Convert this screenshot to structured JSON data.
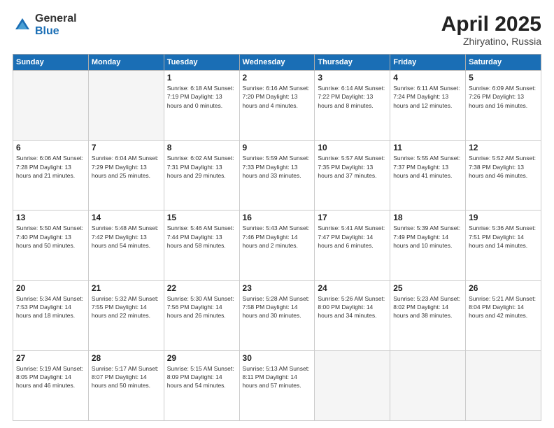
{
  "logo": {
    "general": "General",
    "blue": "Blue"
  },
  "title": "April 2025",
  "subtitle": "Zhiryatino, Russia",
  "weekdays": [
    "Sunday",
    "Monday",
    "Tuesday",
    "Wednesday",
    "Thursday",
    "Friday",
    "Saturday"
  ],
  "weeks": [
    [
      {
        "day": "",
        "info": ""
      },
      {
        "day": "",
        "info": ""
      },
      {
        "day": "1",
        "info": "Sunrise: 6:18 AM\nSunset: 7:19 PM\nDaylight: 13 hours\nand 0 minutes."
      },
      {
        "day": "2",
        "info": "Sunrise: 6:16 AM\nSunset: 7:20 PM\nDaylight: 13 hours\nand 4 minutes."
      },
      {
        "day": "3",
        "info": "Sunrise: 6:14 AM\nSunset: 7:22 PM\nDaylight: 13 hours\nand 8 minutes."
      },
      {
        "day": "4",
        "info": "Sunrise: 6:11 AM\nSunset: 7:24 PM\nDaylight: 13 hours\nand 12 minutes."
      },
      {
        "day": "5",
        "info": "Sunrise: 6:09 AM\nSunset: 7:26 PM\nDaylight: 13 hours\nand 16 minutes."
      }
    ],
    [
      {
        "day": "6",
        "info": "Sunrise: 6:06 AM\nSunset: 7:28 PM\nDaylight: 13 hours\nand 21 minutes."
      },
      {
        "day": "7",
        "info": "Sunrise: 6:04 AM\nSunset: 7:29 PM\nDaylight: 13 hours\nand 25 minutes."
      },
      {
        "day": "8",
        "info": "Sunrise: 6:02 AM\nSunset: 7:31 PM\nDaylight: 13 hours\nand 29 minutes."
      },
      {
        "day": "9",
        "info": "Sunrise: 5:59 AM\nSunset: 7:33 PM\nDaylight: 13 hours\nand 33 minutes."
      },
      {
        "day": "10",
        "info": "Sunrise: 5:57 AM\nSunset: 7:35 PM\nDaylight: 13 hours\nand 37 minutes."
      },
      {
        "day": "11",
        "info": "Sunrise: 5:55 AM\nSunset: 7:37 PM\nDaylight: 13 hours\nand 41 minutes."
      },
      {
        "day": "12",
        "info": "Sunrise: 5:52 AM\nSunset: 7:38 PM\nDaylight: 13 hours\nand 46 minutes."
      }
    ],
    [
      {
        "day": "13",
        "info": "Sunrise: 5:50 AM\nSunset: 7:40 PM\nDaylight: 13 hours\nand 50 minutes."
      },
      {
        "day": "14",
        "info": "Sunrise: 5:48 AM\nSunset: 7:42 PM\nDaylight: 13 hours\nand 54 minutes."
      },
      {
        "day": "15",
        "info": "Sunrise: 5:46 AM\nSunset: 7:44 PM\nDaylight: 13 hours\nand 58 minutes."
      },
      {
        "day": "16",
        "info": "Sunrise: 5:43 AM\nSunset: 7:46 PM\nDaylight: 14 hours\nand 2 minutes."
      },
      {
        "day": "17",
        "info": "Sunrise: 5:41 AM\nSunset: 7:47 PM\nDaylight: 14 hours\nand 6 minutes."
      },
      {
        "day": "18",
        "info": "Sunrise: 5:39 AM\nSunset: 7:49 PM\nDaylight: 14 hours\nand 10 minutes."
      },
      {
        "day": "19",
        "info": "Sunrise: 5:36 AM\nSunset: 7:51 PM\nDaylight: 14 hours\nand 14 minutes."
      }
    ],
    [
      {
        "day": "20",
        "info": "Sunrise: 5:34 AM\nSunset: 7:53 PM\nDaylight: 14 hours\nand 18 minutes."
      },
      {
        "day": "21",
        "info": "Sunrise: 5:32 AM\nSunset: 7:55 PM\nDaylight: 14 hours\nand 22 minutes."
      },
      {
        "day": "22",
        "info": "Sunrise: 5:30 AM\nSunset: 7:56 PM\nDaylight: 14 hours\nand 26 minutes."
      },
      {
        "day": "23",
        "info": "Sunrise: 5:28 AM\nSunset: 7:58 PM\nDaylight: 14 hours\nand 30 minutes."
      },
      {
        "day": "24",
        "info": "Sunrise: 5:26 AM\nSunset: 8:00 PM\nDaylight: 14 hours\nand 34 minutes."
      },
      {
        "day": "25",
        "info": "Sunrise: 5:23 AM\nSunset: 8:02 PM\nDaylight: 14 hours\nand 38 minutes."
      },
      {
        "day": "26",
        "info": "Sunrise: 5:21 AM\nSunset: 8:04 PM\nDaylight: 14 hours\nand 42 minutes."
      }
    ],
    [
      {
        "day": "27",
        "info": "Sunrise: 5:19 AM\nSunset: 8:05 PM\nDaylight: 14 hours\nand 46 minutes."
      },
      {
        "day": "28",
        "info": "Sunrise: 5:17 AM\nSunset: 8:07 PM\nDaylight: 14 hours\nand 50 minutes."
      },
      {
        "day": "29",
        "info": "Sunrise: 5:15 AM\nSunset: 8:09 PM\nDaylight: 14 hours\nand 54 minutes."
      },
      {
        "day": "30",
        "info": "Sunrise: 5:13 AM\nSunset: 8:11 PM\nDaylight: 14 hours\nand 57 minutes."
      },
      {
        "day": "",
        "info": ""
      },
      {
        "day": "",
        "info": ""
      },
      {
        "day": "",
        "info": ""
      }
    ]
  ]
}
